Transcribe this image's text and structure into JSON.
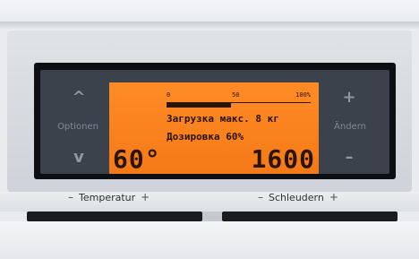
{
  "left_controls": {
    "up_glyph": "^",
    "label": "Optionen",
    "down_glyph": "v"
  },
  "right_controls": {
    "plus_glyph": "+",
    "label": "Ändern",
    "minus_glyph": "–"
  },
  "display": {
    "scale_min": "0",
    "scale_mid": "50",
    "scale_max": "100%",
    "load_fraction": 0.45,
    "line1": "Загрузка макс. 8 кг",
    "line2": "Дозировка 60%",
    "temperature": "60°",
    "spin_speed": "1600"
  },
  "knobs": {
    "temperature": {
      "minus": "–",
      "label": "Temperatur",
      "plus": "+"
    },
    "spin": {
      "minus": "–",
      "label": "Schleudern",
      "plus": "+"
    }
  },
  "colors": {
    "lcd_background": "#f47a17",
    "lcd_text": "#2a1405",
    "panel": "#3b424b"
  }
}
